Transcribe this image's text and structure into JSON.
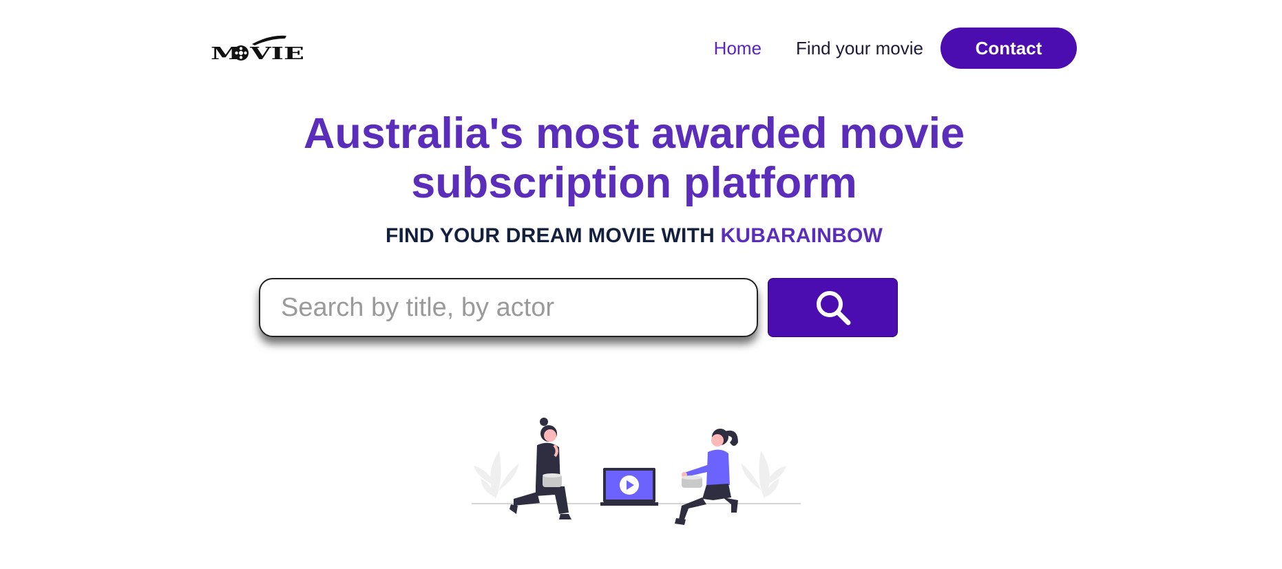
{
  "header": {
    "logo_text": "MOVIE",
    "nav": [
      {
        "label": "Home",
        "active": true
      },
      {
        "label": "Find your movie",
        "active": false
      }
    ],
    "contact_label": "Contact"
  },
  "hero": {
    "title": "Australia's most awarded movie subscription platform",
    "subtitle_prefix": "FIND YOUR DREAM MOVIE WITH ",
    "subtitle_brand": "KUBARAINBOW"
  },
  "search": {
    "placeholder": "Search by title, by actor",
    "value": "",
    "button_icon": "search-icon"
  },
  "colors": {
    "accent": "#4b0cb0",
    "title": "#5a2dbb",
    "dark_text": "#13203e",
    "illustration_purple": "#6c63ff"
  }
}
